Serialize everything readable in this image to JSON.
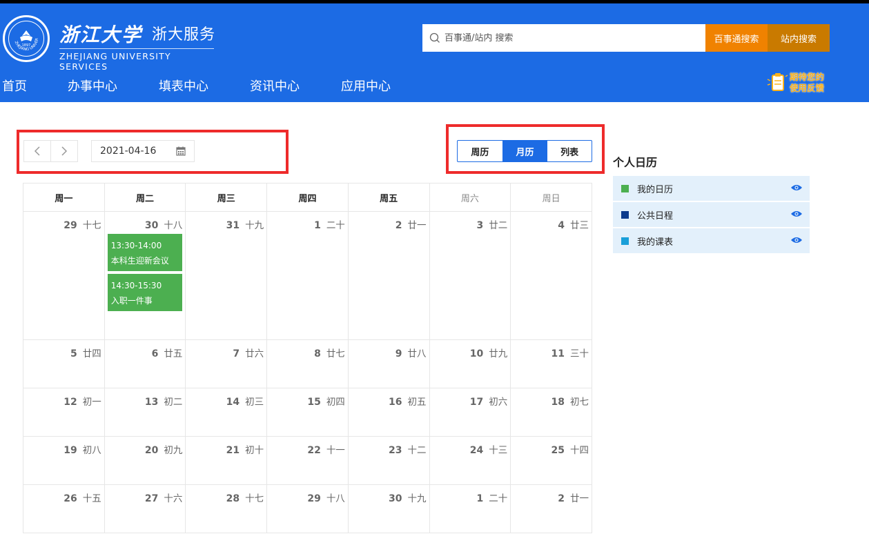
{
  "header": {
    "logo_cn": "浙江大学",
    "logo_service": "浙大服务",
    "logo_en": "ZHEJIANG UNIVERSITY SERVICES",
    "seal_text": "ZHEJIANG UNIVERSITY",
    "seal_year": "1897",
    "search_placeholder": "百事通/站内 搜索",
    "btn_baishi": "百事通搜索",
    "btn_site": "站内搜索",
    "feedback": "期待您的使用反馈",
    "nav": [
      "首页",
      "办事中心",
      "填表中心",
      "资讯中心",
      "应用中心"
    ]
  },
  "toolbar": {
    "date_value": "2021-04-16",
    "view_tabs": [
      {
        "label": "周历",
        "active": false
      },
      {
        "label": "月历",
        "active": true
      },
      {
        "label": "列表",
        "active": false
      }
    ]
  },
  "calendar": {
    "weekdays": [
      "周一",
      "周二",
      "周三",
      "周四",
      "周五",
      "周六",
      "周日"
    ],
    "weeks": [
      [
        {
          "day": "29",
          "lunar": "十七"
        },
        {
          "day": "30",
          "lunar": "十八",
          "events": [
            {
              "time": "13:30-14:00",
              "title": "本科生迎新会议"
            },
            {
              "time": "14:30-15:30",
              "title": "入职一件事"
            }
          ]
        },
        {
          "day": "31",
          "lunar": "十九"
        },
        {
          "day": "1",
          "lunar": "二十"
        },
        {
          "day": "2",
          "lunar": "廿一"
        },
        {
          "day": "3",
          "lunar": "廿二"
        },
        {
          "day": "4",
          "lunar": "廿三"
        }
      ],
      [
        {
          "day": "5",
          "lunar": "廿四"
        },
        {
          "day": "6",
          "lunar": "廿五"
        },
        {
          "day": "7",
          "lunar": "廿六"
        },
        {
          "day": "8",
          "lunar": "廿七"
        },
        {
          "day": "9",
          "lunar": "廿八"
        },
        {
          "day": "10",
          "lunar": "廿九"
        },
        {
          "day": "11",
          "lunar": "三十"
        }
      ],
      [
        {
          "day": "12",
          "lunar": "初一"
        },
        {
          "day": "13",
          "lunar": "初二"
        },
        {
          "day": "14",
          "lunar": "初三"
        },
        {
          "day": "15",
          "lunar": "初四"
        },
        {
          "day": "16",
          "lunar": "初五"
        },
        {
          "day": "17",
          "lunar": "初六"
        },
        {
          "day": "18",
          "lunar": "初七"
        }
      ],
      [
        {
          "day": "19",
          "lunar": "初八"
        },
        {
          "day": "20",
          "lunar": "初九"
        },
        {
          "day": "21",
          "lunar": "初十"
        },
        {
          "day": "22",
          "lunar": "十一"
        },
        {
          "day": "23",
          "lunar": "十二"
        },
        {
          "day": "24",
          "lunar": "十三"
        },
        {
          "day": "25",
          "lunar": "十四"
        }
      ],
      [
        {
          "day": "26",
          "lunar": "十五"
        },
        {
          "day": "27",
          "lunar": "十六"
        },
        {
          "day": "28",
          "lunar": "十七"
        },
        {
          "day": "29",
          "lunar": "十八"
        },
        {
          "day": "30",
          "lunar": "十九"
        },
        {
          "day": "1",
          "lunar": "二十"
        },
        {
          "day": "2",
          "lunar": "廿一"
        }
      ]
    ]
  },
  "sidebar": {
    "title": "个人日历",
    "calendars": [
      {
        "label": "我的日历",
        "color": "#4caf50"
      },
      {
        "label": "公共日程",
        "color": "#0d3b8c"
      },
      {
        "label": "我的课表",
        "color": "#1a9fd9"
      }
    ]
  },
  "colors": {
    "brand_blue": "#1c6be4",
    "search_orange": "#f08200",
    "site_search": "#c97a00",
    "event_green": "#4caf50",
    "highlight_red": "#ee2b2b"
  }
}
